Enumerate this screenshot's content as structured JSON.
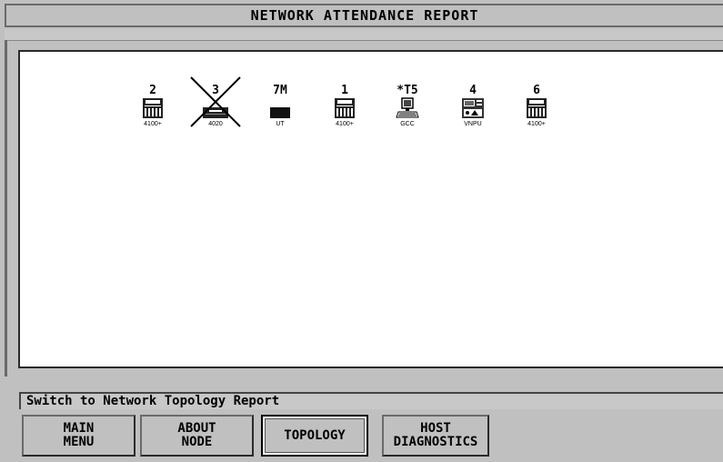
{
  "window": {
    "title": "NETWORK ATTENDANCE REPORT"
  },
  "nodes": [
    {
      "id": "2",
      "type": "4100+",
      "icon": "panel-icon",
      "offline": false
    },
    {
      "id": "3",
      "type": "4020",
      "icon": "panel-icon",
      "offline": true
    },
    {
      "id": "7M",
      "type": "UT",
      "icon": "bar-icon",
      "offline": false
    },
    {
      "id": "1",
      "type": "4100+",
      "icon": "panel-icon",
      "offline": false
    },
    {
      "id": "*T5",
      "type": "GCC",
      "icon": "computer-icon",
      "offline": false
    },
    {
      "id": "4",
      "type": "VNPU",
      "icon": "vnpu-icon",
      "offline": false
    },
    {
      "id": "6",
      "type": "4100+",
      "icon": "panel-icon",
      "offline": false
    }
  ],
  "status": {
    "text": "Switch to Network Topology Report"
  },
  "buttons": [
    {
      "line1": "MAIN",
      "line2": "MENU",
      "selected": false
    },
    {
      "line1": "ABOUT",
      "line2": "NODE",
      "selected": false
    },
    {
      "line1": "TOPOLOGY",
      "line2": "",
      "selected": true
    },
    {
      "line1": "HOST",
      "line2": "DIAGNOSTICS",
      "selected": false
    }
  ]
}
